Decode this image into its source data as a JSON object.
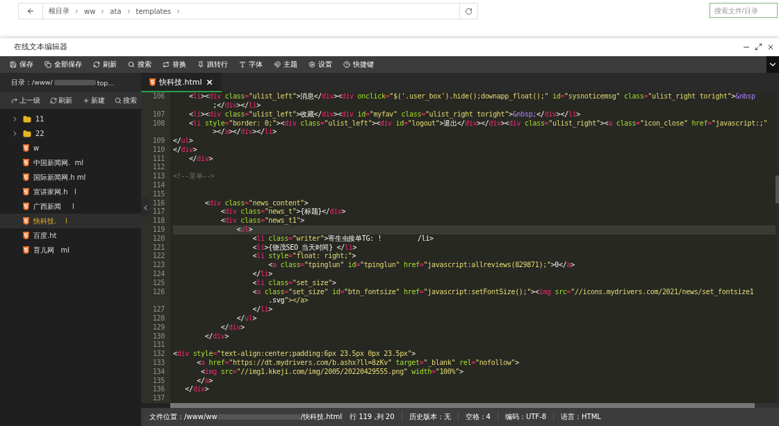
{
  "top_bar": {
    "breadcrumb": [
      "根目录",
      "ww",
      "ata",
      "templates"
    ],
    "search": {
      "placeholder": "搜索文件/目录"
    }
  },
  "window": {
    "title": "在线文本编辑器"
  },
  "toolbar": [
    "保存",
    "全部保存",
    "刷新",
    "搜索",
    "替换",
    "跳转行",
    "字体",
    "主题",
    "设置",
    "快捷键"
  ],
  "sidebar": {
    "path_start": "目录：/www/",
    "path_end": "top...",
    "actions": [
      "上一级",
      "刷新",
      "新建",
      "搜索"
    ],
    "items": [
      {
        "kind": "folder",
        "name": "11",
        "selected": false
      },
      {
        "kind": "folder",
        "name": "22",
        "selected": false
      },
      {
        "kind": "file",
        "name": "w",
        "selected": false
      },
      {
        "kind": "file",
        "name": "中国新闻网.  ml",
        "selected": false
      },
      {
        "kind": "file",
        "name": "国际新闻网.h ml",
        "selected": false
      },
      {
        "kind": "file",
        "name": "宣讲家网.h   l",
        "selected": false
      },
      {
        "kind": "file",
        "name": "广西新闻     l",
        "selected": false
      },
      {
        "kind": "file",
        "name": "快科技.    l",
        "selected": true
      },
      {
        "kind": "file",
        "name": "百度.ht",
        "selected": false
      },
      {
        "kind": "file",
        "name": "育儿网   ml",
        "selected": false
      }
    ]
  },
  "tabs": [
    {
      "label": "快科技.html",
      "selected": true
    }
  ],
  "code_lines": [
    {
      "number": "106",
      "text": "    <li><div class=\"ulist_left\">消息</div><div onclick=\"$('.user_box').hide();downapp_float();\" id=\"sysnoticemsg\" class=\"ulist_right toright\">&nbsp",
      "current": false
    },
    {
      "text": "          ;</div></li>",
      "current": false
    },
    {
      "number": "107",
      "text": "    <li><div class=\"ulist_left\">收藏</div><div id=\"myfav\" class=\"ulist_right toright\">&nbsp;</div></li>",
      "current": false
    },
    {
      "number": "108",
      "text": "    <li style=\"border: 0;\"><div class=\"ulist_left\"><div id=\"logout\">退出</div></div><div class=\"ulist_right\"><a class=\"icon_close\" href=\"javascript:;\"",
      "current": false
    },
    {
      "text": "          ></a></div></li>",
      "current": false
    },
    {
      "number": "109",
      "text": "</ul>",
      "current": false
    },
    {
      "number": "110",
      "text": "</div>",
      "current": false
    },
    {
      "number": "111",
      "text": "    </div>",
      "current": false
    },
    {
      "number": "112",
      "current": false
    },
    {
      "number": "113",
      "text": "<!--菜单-->",
      "current": false
    },
    {
      "number": "114",
      "current": false
    },
    {
      "number": "115",
      "current": false
    },
    {
      "number": "116",
      "text": "        <div class=\"news_content\">",
      "current": false
    },
    {
      "number": "117",
      "text": "            <div class=\"news_t\">{标题}</div>",
      "current": false
    },
    {
      "number": "118",
      "text": "            <div class=\"news_t1\">",
      "current": false
    },
    {
      "number": "119",
      "text": "                <ul>",
      "current": true
    },
    {
      "number": "120",
      "text": "                    <li class=\"writer\">寄生虫接单TG: !         /li>",
      "current": false
    },
    {
      "number": "121",
      "text": "                    <li>{饶茂SEO_当天时间} </li>",
      "current": false
    },
    {
      "number": "122",
      "text": "                    <li style=\"float: right;\">",
      "current": false
    },
    {
      "number": "123",
      "text": "                        <a class=\"tpinglun\" id=\"tpinglun\" href=\"javascript:allreviews(829871);\">0</a>",
      "current": false
    },
    {
      "number": "124",
      "text": "                    </li>",
      "current": false
    },
    {
      "number": "125",
      "text": "                    <li class=\"set_size\">",
      "current": false
    },
    {
      "number": "126",
      "text": "                    <a class=\"set_size\" id=\"btn_fontsize\" href=\"javascript:setFontSize();\"><img src=\"//icons.mydrivers.com/2021/news/set_fontsize1",
      "current": false
    },
    {
      "text": "                        .svg\"></a>",
      "current": false
    },
    {
      "number": "127",
      "text": "                    </li>",
      "current": false
    },
    {
      "number": "128",
      "text": "                </ul>",
      "current": false
    },
    {
      "number": "129",
      "text": "            </div>",
      "current": false
    },
    {
      "number": "130",
      "text": "        </div>",
      "current": false
    },
    {
      "number": "131",
      "current": false
    },
    {
      "number": "132",
      "text": "<div style=\"text-align:center;padding:6px 23.5px 0px 23.5px\">",
      "current": false
    },
    {
      "number": "133",
      "text": "      <a href=\"https://dt.mydrivers.com/b.ashx?ll=8zKv\" target=\"_blank\" rel=\"nofollow\">",
      "current": false
    },
    {
      "number": "134",
      "text": "       <img src=\"//img1.kkeji.com/img/2005/20220429555.png\" width=\"100%\">",
      "current": false
    },
    {
      "number": "135",
      "text": "      </a>",
      "current": false
    },
    {
      "number": "136",
      "text": "   </div>",
      "current": false
    },
    {
      "number": "137",
      "current": false
    }
  ],
  "status_bar": {
    "file_path_start": "文件位置：/www/ww",
    "file_path_end": "/快科技.html",
    "items": [
      "行 119 ,列 20",
      "历史版本：无",
      "空格：4",
      "编码：UTF-8",
      "语言：HTML"
    ]
  }
}
